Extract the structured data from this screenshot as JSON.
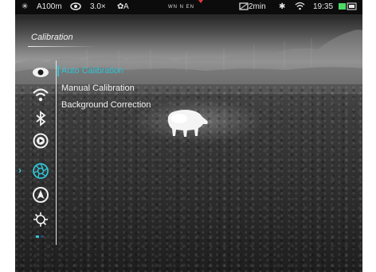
{
  "status_bar": {
    "range": "A100m",
    "zoom": "3.0×",
    "calibration_mode": "A",
    "compass": "WN        N        EN",
    "record_time": "2min",
    "clock": "19:35"
  },
  "page": {
    "title": "Calibration"
  },
  "side_menu": {
    "icons": [
      "eye-icon",
      "wifi-icon",
      "bluetooth-icon",
      "record-icon",
      "calibration-shutter-icon",
      "navigation-icon",
      "settings-gear-icon",
      "page-indicator-icon"
    ],
    "selected_index": 4
  },
  "submenu": {
    "items": [
      "Auto Calibration",
      "Manual Calibration",
      "Background Correction"
    ],
    "selected_index": 0
  },
  "colors": {
    "accent": "#2fc3d3",
    "text": "#f0f0f0",
    "status_bg": "#0c0c0c",
    "battery": "#4cd964",
    "compass_marker": "#e53935"
  }
}
